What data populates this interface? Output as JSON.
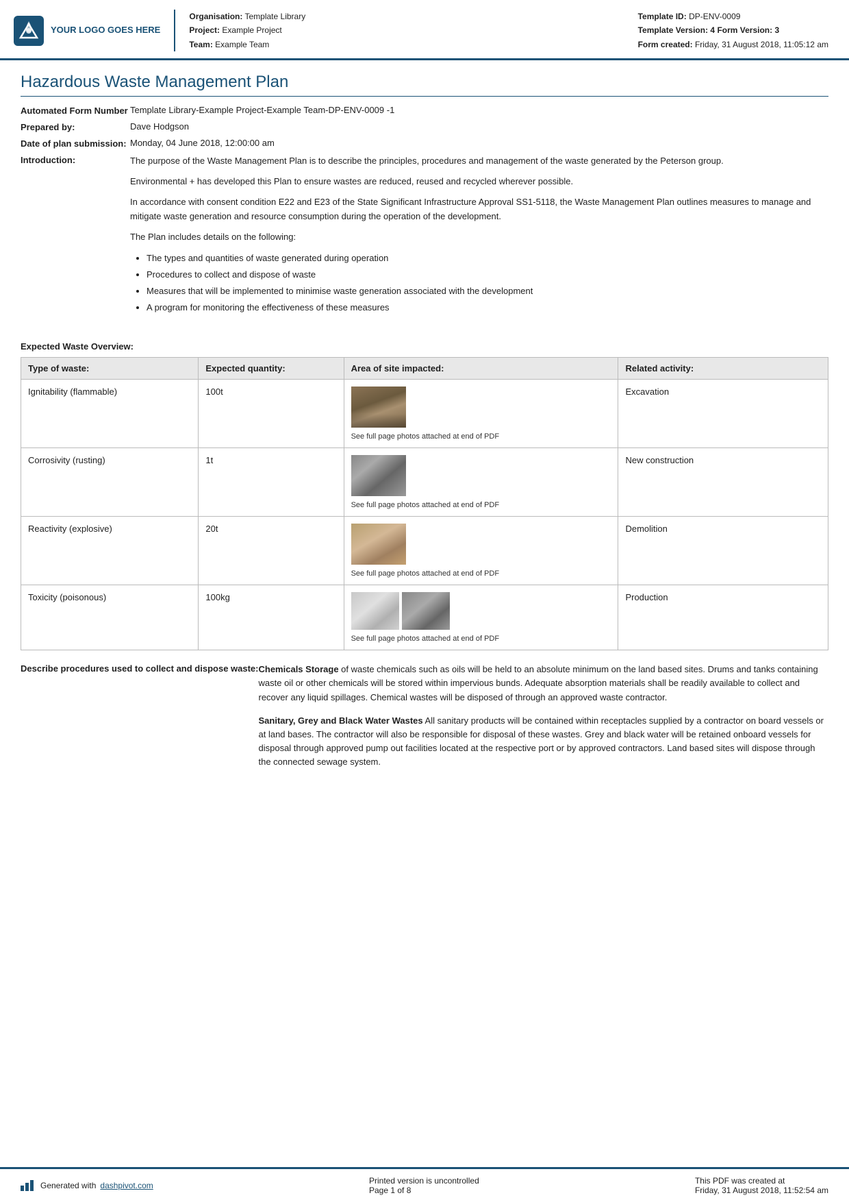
{
  "header": {
    "logo_text": "YOUR LOGO GOES HERE",
    "org_label": "Organisation:",
    "org_value": "Template Library",
    "project_label": "Project:",
    "project_value": "Example Project",
    "team_label": "Team:",
    "team_value": "Example Team",
    "template_id_label": "Template ID:",
    "template_id_value": "DP-ENV-0009",
    "template_version_label": "Template Version:",
    "template_version_value": "4",
    "form_version_label": "Form Version:",
    "form_version_value": "3",
    "form_created_label": "Form created:",
    "form_created_value": "Friday, 31 August 2018, 11:05:12 am"
  },
  "title": "Hazardous Waste Management Plan",
  "form_fields": {
    "form_number_label": "Automated Form Number",
    "form_number_value": "Template Library-Example Project-Example Team-DP-ENV-0009   -1",
    "prepared_by_label": "Prepared by:",
    "prepared_by_value": "Dave Hodgson",
    "date_label": "Date of plan submission:",
    "date_value": "Monday, 04 June 2018, 12:00:00 am",
    "intro_label": "Introduction:"
  },
  "introduction": {
    "para1": "The purpose of the Waste Management Plan is to describe the principles, procedures and management of the waste generated by the Peterson group.",
    "para2": "Environmental + has developed this Plan to ensure wastes are reduced, reused and recycled wherever possible.",
    "para3": "In accordance with consent condition E22 and E23 of the State Significant Infrastructure Approval SS1-5118, the Waste Management Plan outlines measures to manage and mitigate waste generation and resource consumption during the operation of the development.",
    "para4": "The Plan includes details on the following:",
    "bullets": [
      "The types and quantities of waste generated during operation",
      "Procedures to collect and dispose of waste",
      "Measures that will be implemented to minimise waste generation associated with the development",
      "A program for monitoring the effectiveness of these measures"
    ]
  },
  "waste_table": {
    "section_title": "Expected Waste Overview:",
    "headers": [
      "Type of waste:",
      "Expected quantity:",
      "Area of site impacted:",
      "Related activity:"
    ],
    "rows": [
      {
        "type": "Ignitability (flammable)",
        "quantity": "100t",
        "photo_caption": "See full page photos attached at end of PDF",
        "activity": "Excavation"
      },
      {
        "type": "Corrosivity (rusting)",
        "quantity": "1t",
        "photo_caption": "See full page photos attached at end of PDF",
        "activity": "New construction"
      },
      {
        "type": "Reactivity (explosive)",
        "quantity": "20t",
        "photo_caption": "See full page photos attached at end of PDF",
        "activity": "Demolition"
      },
      {
        "type": "Toxicity (poisonous)",
        "quantity": "100kg",
        "photo_caption": "See full page photos attached at end of PDF",
        "activity": "Production"
      }
    ]
  },
  "describe_section": {
    "label": "Describe procedures used to collect and dispose waste:",
    "para1_bold": "Chemicals Storage",
    "para1_text": " of waste chemicals such as oils will be held to an absolute minimum on the land based sites. Drums and tanks containing waste oil or other chemicals will be stored within impervious bunds. Adequate absorption materials shall be readily available to collect and recover any liquid spillages. Chemical wastes will be disposed of through an approved waste contractor.",
    "para2_bold": "Sanitary, Grey and Black Water Wastes",
    "para2_text": " All sanitary products will be contained within receptacles supplied by a contractor on board vessels or at land bases. The contractor will also be responsible for disposal of these wastes. Grey and black water will be retained onboard vessels for disposal through approved pump out facilities located at the respective port or by approved contractors. Land based sites will dispose through the connected sewage system."
  },
  "footer": {
    "generated_text": "Generated with",
    "link_text": "dashpivot.com",
    "center_text": "Printed version is uncontrolled",
    "page_text": "Page 1 of 8",
    "right_text": "This PDF was created at",
    "right_date": "Friday, 31 August 2018, 11:52:54 am"
  }
}
